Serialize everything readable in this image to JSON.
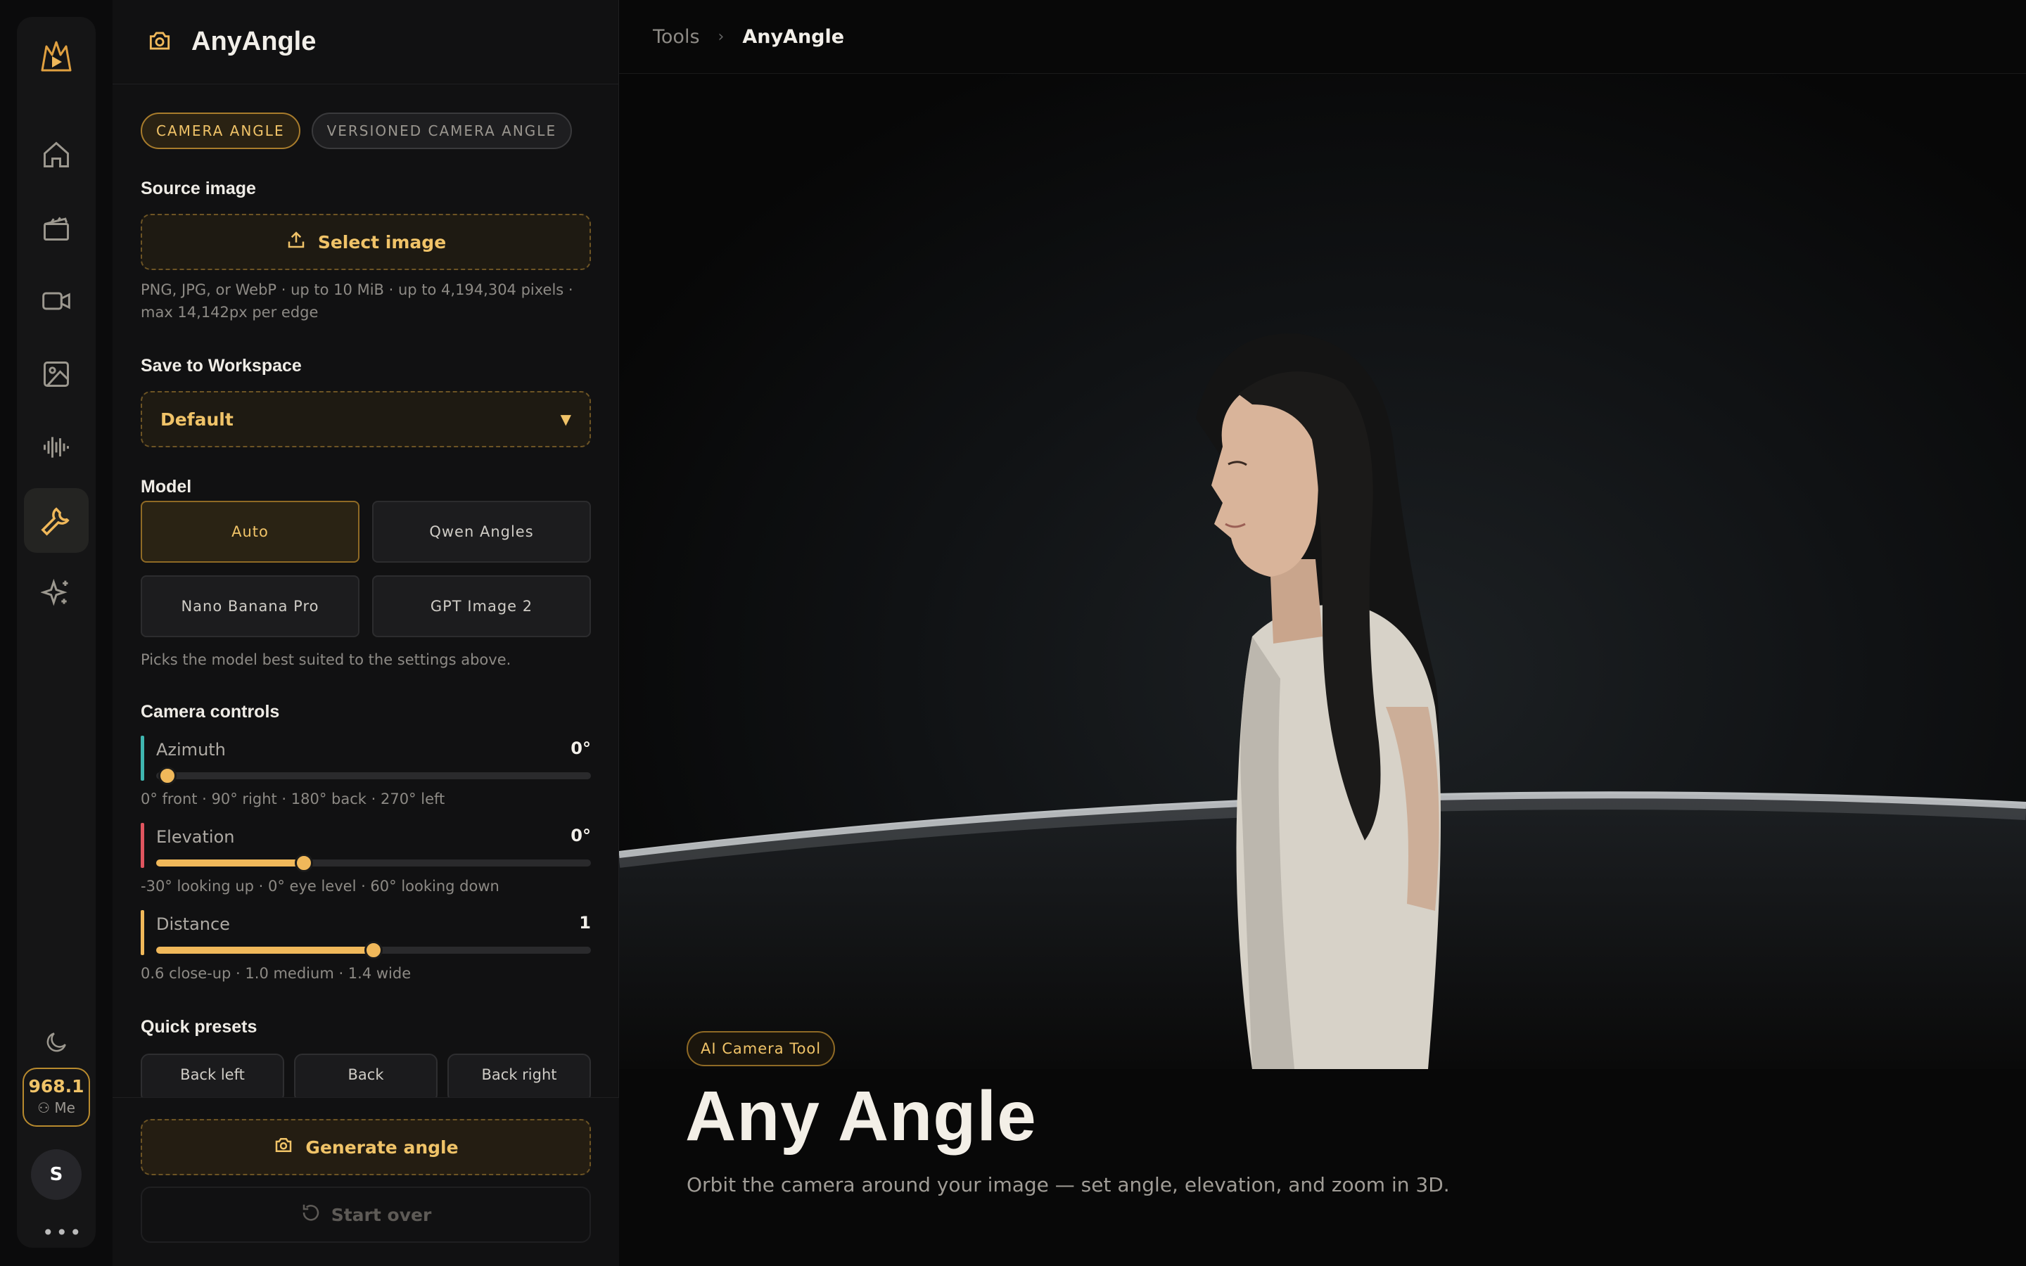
{
  "rail": {
    "nav": [
      "home-icon",
      "clapperboard-icon",
      "video-camera-icon",
      "image-icon",
      "audio-waveform-icon",
      "wrench-icon",
      "sparkles-icon"
    ],
    "active": "wrench-icon",
    "credits": "968.1",
    "me_label": "Me",
    "avatar_initial": "S"
  },
  "panel": {
    "title": "AnyAngle",
    "tabs": [
      {
        "label": "CAMERA ANGLE",
        "active": true
      },
      {
        "label": "VERSIONED CAMERA ANGLE",
        "active": false
      }
    ],
    "source": {
      "label": "Source image",
      "button": "Select image",
      "help": "PNG, JPG, or WebP · up to 10 MiB · up to 4,194,304 pixels · max 14,142px per edge"
    },
    "workspace": {
      "label": "Save to Workspace",
      "selected": "Default"
    },
    "model": {
      "label": "Model",
      "options": [
        "Auto",
        "Qwen Angles",
        "Nano Banana Pro",
        "GPT Image 2"
      ],
      "selected": "Auto",
      "help": "Picks the model best suited to the settings above."
    },
    "camera": {
      "label": "Camera controls",
      "sliders": [
        {
          "name": "Azimuth",
          "value": "0°",
          "fraction": 0.0,
          "color": "#3fb6b0",
          "help": "0° front · 90° right · 180° back · 270° left"
        },
        {
          "name": "Elevation",
          "value": "0°",
          "fraction": 0.34,
          "color": "#e0555f",
          "help": "-30° looking up · 0° eye level · 60° looking down"
        },
        {
          "name": "Distance",
          "value": "1",
          "fraction": 0.5,
          "color": "#f0b85a",
          "help": "0.6 close-up · 1.0 medium · 1.4 wide"
        }
      ]
    },
    "presets": {
      "label": "Quick presets",
      "items": [
        "Back left",
        "Back",
        "Back right"
      ]
    },
    "generate_label": "Generate angle",
    "reset_label": "Start over"
  },
  "main": {
    "breadcrumb": [
      "Tools",
      "AnyAngle"
    ],
    "badge": "AI Camera Tool",
    "title": "Any Angle",
    "subtitle": "Orbit the camera around your image — set angle, elevation, and zoom in 3D."
  },
  "colors": {
    "accent": "#f0c368",
    "background": "#0b0b0c"
  }
}
